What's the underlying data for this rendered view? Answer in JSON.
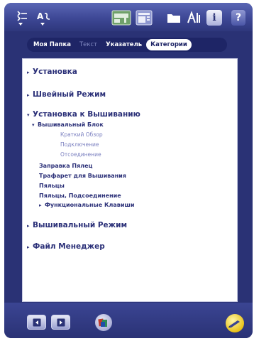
{
  "tabs": [
    {
      "label": "Моя Папка",
      "state": "normal"
    },
    {
      "label": "Текст",
      "state": "disabled"
    },
    {
      "label": "Указатель",
      "state": "normal"
    },
    {
      "label": "Категории",
      "state": "selected"
    }
  ],
  "toolbar": {
    "icons": [
      "bookmark-list-icon",
      "spell-check-icon",
      "sewing-machine-icon",
      "document-icon",
      "folder-icon",
      "tools-icon",
      "info-icon",
      "help-icon"
    ],
    "help_label": "?",
    "info_label": "i"
  },
  "tree": [
    {
      "level": 1,
      "expanded": false,
      "label": "Установка"
    },
    {
      "level": 1,
      "expanded": false,
      "label": "Швейный Режим"
    },
    {
      "level": 1,
      "expanded": true,
      "label": "Установка к Вышиванию"
    },
    {
      "level": 2,
      "expanded": true,
      "label": "Вышивальный Блок"
    },
    {
      "level": 3,
      "label": "Краткий Обзор"
    },
    {
      "level": 3,
      "label": "Подключение"
    },
    {
      "level": 3,
      "label": "Отсоединение"
    },
    {
      "level": 2,
      "label": "Заправка Пялец"
    },
    {
      "level": 2,
      "label": "Трафарет для Вышивания"
    },
    {
      "level": 2,
      "label": "Пяльцы"
    },
    {
      "level": 2,
      "label": "Пяльцы, Подсоединение"
    },
    {
      "level": 2,
      "expanded": false,
      "label": "Функциональные Клавиши"
    },
    {
      "level": 1,
      "expanded": false,
      "label": "Вышивальный Режим"
    },
    {
      "level": 1,
      "expanded": false,
      "label": "Файл Менеджер"
    }
  ],
  "colors": {
    "frame": "#2a3275",
    "toolbar": "#3d4795",
    "tab_bar": "#1e2566",
    "text_main": "#2b3078",
    "text_sub": "#7b80c0",
    "accent_pen": "#e9c21a"
  }
}
